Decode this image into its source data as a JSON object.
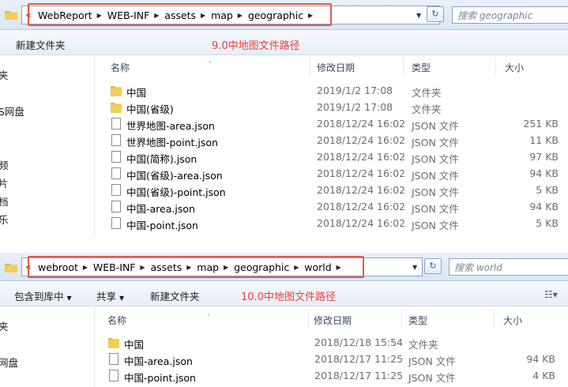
{
  "top": {
    "address_crumbs": [
      "WebReport",
      "WEB-INF",
      "assets",
      "map",
      "geographic"
    ],
    "search_placeholder": "搜索 geographic",
    "toolbar": {
      "new_folder": "新建文件夹"
    },
    "annotation": "9.0中地图文件路径",
    "nav_items": [
      "夹",
      "S网盘",
      "频",
      "片",
      "档",
      "乐"
    ],
    "columns": {
      "name": "名称",
      "date": "修改日期",
      "type": "类型",
      "size": "大小"
    },
    "files": [
      {
        "name": "中国",
        "date": "2019/1/2 17:08",
        "type": "文件夹",
        "size": "",
        "kind": "folder"
      },
      {
        "name": "中国(省级)",
        "date": "2019/1/2 17:08",
        "type": "文件夹",
        "size": "",
        "kind": "folder"
      },
      {
        "name": "世界地图-area.json",
        "date": "2018/12/24 16:02",
        "type": "JSON 文件",
        "size": "251 KB",
        "kind": "file"
      },
      {
        "name": "世界地图-point.json",
        "date": "2018/12/24 16:02",
        "type": "JSON 文件",
        "size": "11 KB",
        "kind": "file"
      },
      {
        "name": "中国(简称).json",
        "date": "2018/12/24 16:02",
        "type": "JSON 文件",
        "size": "97 KB",
        "kind": "file"
      },
      {
        "name": "中国(省级)-area.json",
        "date": "2018/12/24 16:02",
        "type": "JSON 文件",
        "size": "94 KB",
        "kind": "file"
      },
      {
        "name": "中国(省级)-point.json",
        "date": "2018/12/24 16:02",
        "type": "JSON 文件",
        "size": "5 KB",
        "kind": "file"
      },
      {
        "name": "中国-area.json",
        "date": "2018/12/24 16:02",
        "type": "JSON 文件",
        "size": "94 KB",
        "kind": "file"
      },
      {
        "name": "中国-point.json",
        "date": "2018/12/24 16:02",
        "type": "JSON 文件",
        "size": "5 KB",
        "kind": "file"
      }
    ]
  },
  "bottom": {
    "address_crumbs": [
      "webroot",
      "WEB-INF",
      "assets",
      "map",
      "geographic",
      "world"
    ],
    "search_placeholder": "搜索 world",
    "toolbar": {
      "include_library": "包含到库中",
      "share": "共享",
      "new_folder": "新建文件夹"
    },
    "annotation": "10.0中地图文件路径",
    "nav_items": [
      "夹",
      "网盘"
    ],
    "columns": {
      "name": "名称",
      "date": "修改日期",
      "type": "类型",
      "size": "大小"
    },
    "files": [
      {
        "name": "中国",
        "date": "2018/12/18 15:54",
        "type": "文件夹",
        "size": "",
        "kind": "folder"
      },
      {
        "name": "中国-area.json",
        "date": "2018/12/17 11:25",
        "type": "JSON 文件",
        "size": "94 KB",
        "kind": "file"
      },
      {
        "name": "中国-point.json",
        "date": "2018/12/17 11:25",
        "type": "JSON 文件",
        "size": "4 KB",
        "kind": "file"
      }
    ]
  },
  "colors": {
    "highlight": "#e05a4a",
    "annotation": "#e8423a",
    "folder": "#e8b838"
  },
  "icons": {
    "folder": "folder-icon",
    "file": "file-icon",
    "refresh": "refresh-icon",
    "views": "view-options-icon"
  }
}
